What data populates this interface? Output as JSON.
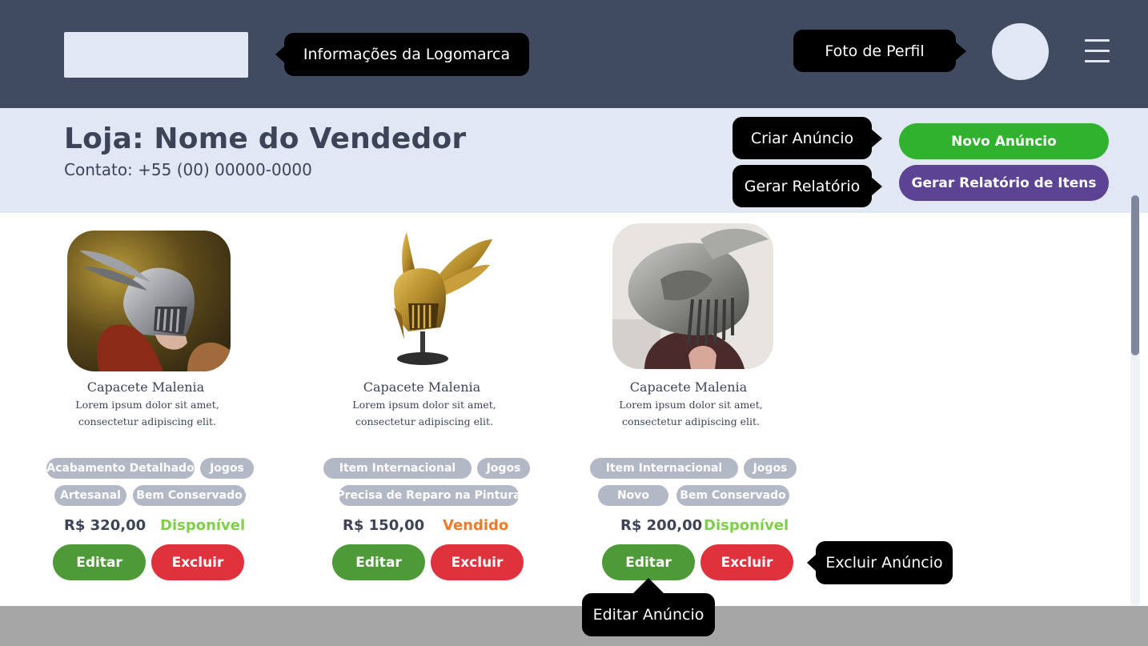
{
  "header": {
    "logo_tip": "Informações da Logomarca",
    "profile_tip": "Foto de Perfil",
    "menu_icon": "hamburger-menu-icon",
    "colors": {
      "background": "#404a61",
      "placeholder": "#e1e7f3"
    }
  },
  "store": {
    "title": "Loja: Nome do Vendedor",
    "contact": "Contato: +55 (00) 00000-0000",
    "create_tip": "Criar Anúncio",
    "report_tip": "Gerar Relatório",
    "new_button": "Novo Anúncio",
    "report_button": "Gerar Relatório de Itens",
    "colors": {
      "new_button": "#31b22f",
      "report_button": "#5c4394"
    }
  },
  "products": [
    {
      "name": "Capacete Malenia",
      "desc_line1": "Lorem ipsum dolor sit amet,",
      "desc_line2": "consectetur adipiscing elit.",
      "tags": [
        "Acabamento Detalhado",
        "Jogos",
        "Artesanal",
        "Bem Conservado"
      ],
      "price": "R$ 320,00",
      "status": "Disponível",
      "status_color": "#7fcf4a",
      "edit": "Editar",
      "delete": "Excluir",
      "image_icon": "helmet-photo-icon"
    },
    {
      "name": "Capacete Malenia",
      "desc_line1": "Lorem ipsum dolor sit amet,",
      "desc_line2": "consectetur adipiscing elit.",
      "tags": [
        "Item Internacional",
        "Jogos",
        "Precisa de Reparo na Pintura"
      ],
      "price": "R$ 150,00",
      "status": "Vendido",
      "status_color": "#ee7a2a",
      "edit": "Editar",
      "delete": "Excluir",
      "image_icon": "helmet-on-stand-icon"
    },
    {
      "name": "Capacete Malenia",
      "desc_line1": "Lorem ipsum dolor sit amet,",
      "desc_line2": "consectetur adipiscing elit.",
      "tags": [
        "Item Internacional",
        "Jogos",
        "Novo",
        "Bem Conservado"
      ],
      "price": "R$ 200,00",
      "status": "Disponível",
      "status_color": "#7fcf4a",
      "edit": "Editar",
      "delete": "Excluir",
      "image_icon": "helmet-closeup-photo-icon"
    }
  ],
  "annotations": {
    "delete_tip": "Excluir Anúncio",
    "edit_tip": "Editar Anúncio"
  }
}
